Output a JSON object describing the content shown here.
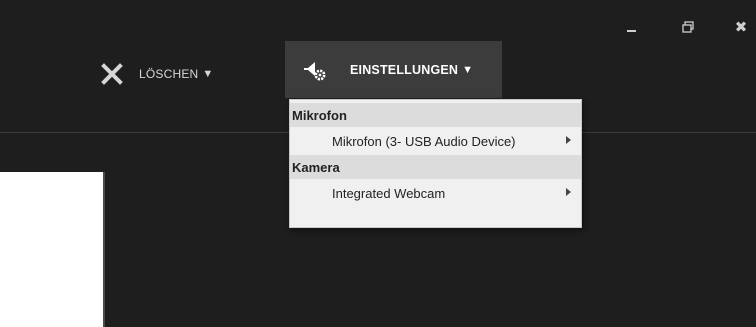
{
  "window": {
    "minimize_icon": "minimize-icon",
    "restore_icon": "restore-icon",
    "close_glyph": "✖"
  },
  "toolbar": {
    "clear_label": "LÖSCHEN",
    "clear_caret": "▼",
    "settings_label": "EINSTELLUNGEN",
    "settings_caret": "▼"
  },
  "settings_menu": {
    "sections": [
      {
        "header": "Mikrofon",
        "item": "Mikrofon (3- USB Audio Device)"
      },
      {
        "header": "Kamera",
        "item": "Integrated Webcam"
      }
    ]
  },
  "colors": {
    "background": "#1e1e1e",
    "active_button": "#3c3c3c",
    "menu_background": "#f0f0f0",
    "menu_header": "#dcdcdc"
  }
}
